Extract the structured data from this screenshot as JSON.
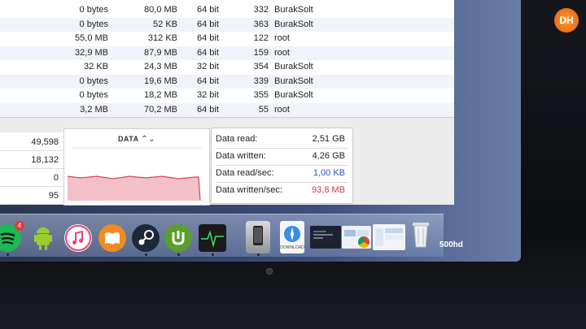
{
  "process_table": {
    "rows": [
      {
        "c1": "0 bytes",
        "c2": "80,0 MB",
        "c3": "64 bit",
        "c4": "332",
        "c5": "BurakSolt"
      },
      {
        "c1": "0 bytes",
        "c2": "52 KB",
        "c3": "64 bit",
        "c4": "363",
        "c5": "BurakSolt"
      },
      {
        "c1": "55,0 MB",
        "c2": "312 KB",
        "c3": "64 bit",
        "c4": "122",
        "c5": "root"
      },
      {
        "c1": "32,9 MB",
        "c2": "87,9 MB",
        "c3": "64 bit",
        "c4": "159",
        "c5": "root"
      },
      {
        "c1": "32 KB",
        "c2": "24,3 MB",
        "c3": "32 bit",
        "c4": "354",
        "c5": "BurakSolt"
      },
      {
        "c1": "0 bytes",
        "c2": "19,6 MB",
        "c3": "64 bit",
        "c4": "339",
        "c5": "BurakSolt"
      },
      {
        "c1": "0 bytes",
        "c2": "18,2 MB",
        "c3": "32 bit",
        "c4": "355",
        "c5": "BurakSolt"
      },
      {
        "c1": "3,2 MB",
        "c2": "70,2 MB",
        "c3": "64 bit",
        "c4": "55",
        "c5": "root"
      }
    ]
  },
  "counts": [
    "49,598",
    "18,132",
    "0",
    "95"
  ],
  "graph": {
    "title": "DATA",
    "arrow": "⌃⌄"
  },
  "stats": [
    {
      "label": "Data read:",
      "value": "2,51 GB",
      "tone": "normal"
    },
    {
      "label": "Data written:",
      "value": "4,26 GB",
      "tone": "normal"
    },
    {
      "label": "Data read/sec:",
      "value": "1,00 KB",
      "tone": "blue"
    },
    {
      "label": "Data written/sec:",
      "value": "93,8 MB",
      "tone": "red"
    }
  ],
  "dock": {
    "spotify_badge": "4",
    "download_label": "DOWNLOAD",
    "apps": [
      "spotify",
      "android-file-transfer",
      "itunes",
      "ibooks",
      "steam",
      "utorrent",
      "activity-monitor",
      "iphone-backup",
      "safari-download",
      "terminal",
      "preview",
      "chrome",
      "finder-window",
      "trash"
    ]
  },
  "colors": {
    "accent_red": "#c83a4a",
    "accent_blue": "#2a55c6",
    "logo_orange": "#f07a1a"
  },
  "logo_text": "DH",
  "screen_text": "500hd"
}
